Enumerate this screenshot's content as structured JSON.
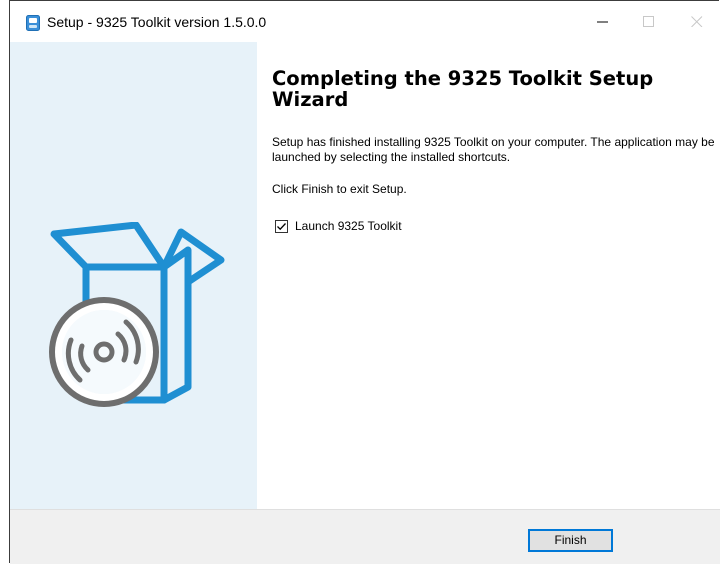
{
  "window": {
    "title": "Setup - 9325 Toolkit version 1.5.0.0"
  },
  "icons": {
    "app": "installer-icon",
    "minimize": "minimize-icon",
    "maximize": "maximize-icon",
    "close": "close-icon",
    "hero": "software-box-disc-icon",
    "check": "checkmark-icon"
  },
  "colors": {
    "sidebar_bg": "#e7f2f9",
    "accent": "#0078d7",
    "box_blue": "#1f8fd2",
    "disc_gray": "#6e6e6e",
    "footer_bg": "#f0f0f0"
  },
  "wizard": {
    "heading": "Completing the 9325 Toolkit Setup Wizard",
    "message": "Setup has finished installing 9325 Toolkit on your computer. The application may be launched by selecting the installed shortcuts.",
    "finish_hint": "Click Finish to exit Setup.",
    "launch_label": "Launch 9325 Toolkit",
    "launch_checked": true
  },
  "footer": {
    "finish_label": "Finish"
  }
}
